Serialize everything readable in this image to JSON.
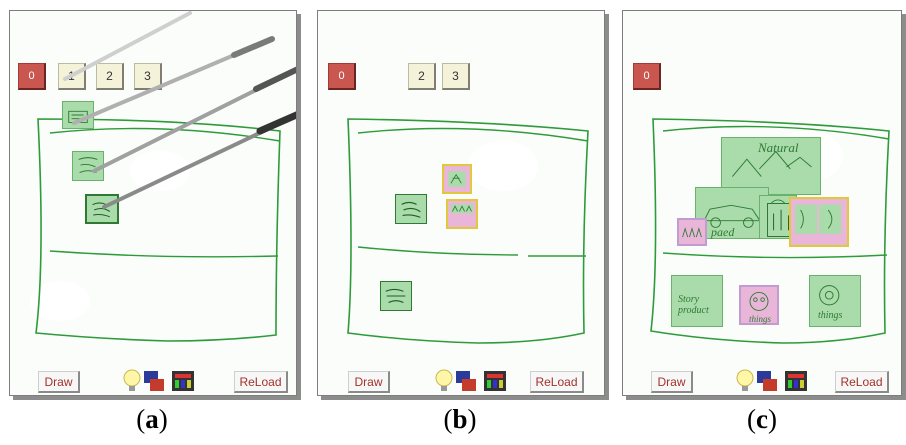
{
  "panels": [
    {
      "id": "a",
      "caption_open": "(",
      "caption_letter": "a",
      "caption_close": ")",
      "buttons": [
        "0",
        "1",
        "2",
        "3"
      ],
      "draw_label": "Draw",
      "reload_label": "ReLoad"
    },
    {
      "id": "b",
      "caption_open": "(",
      "caption_letter": "b",
      "caption_close": ")",
      "buttons": [
        "0",
        "2",
        "3"
      ],
      "draw_label": "Draw",
      "reload_label": "ReLoad"
    },
    {
      "id": "c",
      "caption_open": "(",
      "caption_letter": "c",
      "caption_close": ")",
      "buttons": [
        "0"
      ],
      "draw_label": "Draw",
      "reload_label": "ReLoad",
      "thumb_texts": {
        "title": "Natural",
        "left_label": "paed",
        "note1": "Story product",
        "note2": "things",
        "note3": "things"
      }
    }
  ],
  "colors": {
    "ink": "#2e9b3a",
    "thumb_fill": "#a9dcaa",
    "pink_fill": "#e9b6d9",
    "select_border": "#e2c93c",
    "zero_button": "#c9574f",
    "number_button": "#f4f2d8"
  },
  "icons": [
    "lightbulb-icon",
    "flags-icon",
    "toolbox-icon",
    "pen-icon"
  ]
}
